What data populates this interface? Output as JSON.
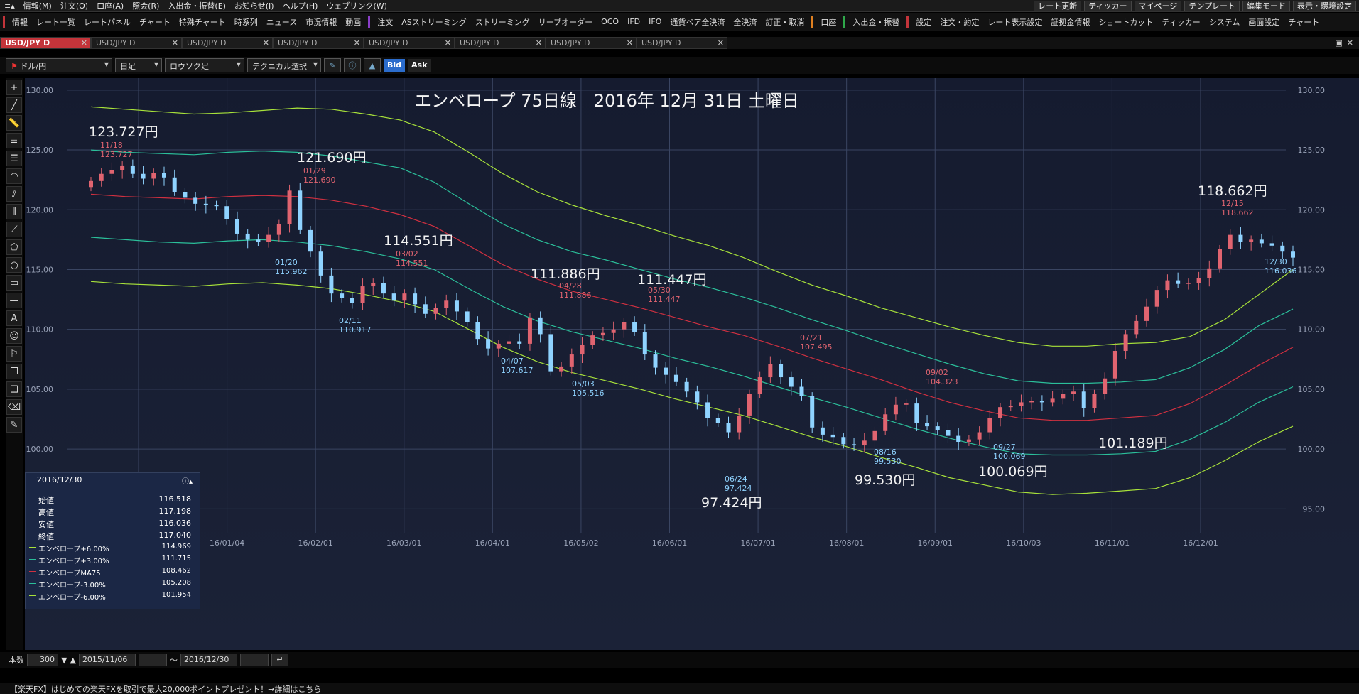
{
  "menu": {
    "left": [
      "情報(M)",
      "注文(O)",
      "口座(A)",
      "照会(R)",
      "入出金・振替(E)",
      "お知らせ(I)",
      "ヘルプ(H)",
      "ウェブリンク(W)"
    ],
    "right": [
      "レート更新",
      "ティッカー",
      "マイページ",
      "テンプレート",
      "編集モード",
      "表示・環境設定"
    ]
  },
  "toolbar": {
    "group1": [
      "情報",
      "レート一覧",
      "レートパネル",
      "チャート",
      "特殊チャート",
      "時系列",
      "ニュース",
      "市況情報",
      "動画"
    ],
    "group2": [
      "注文",
      "ASストリーミング",
      "ストリーミング",
      "リーブオーダー",
      "OCO",
      "IFD",
      "IFO",
      "通貨ペア全決済",
      "全決済",
      "訂正・取消"
    ],
    "group3": [
      "口座"
    ],
    "group4": [
      "入出金・振替"
    ],
    "group5": [
      "設定",
      "注文・約定",
      "レート表示設定",
      "証拠金情報",
      "ショートカット",
      "ティッカー",
      "システム",
      "画面設定",
      "チャート"
    ]
  },
  "tabs": [
    "USD/JPY D",
    "USD/JPY D",
    "USD/JPY D",
    "USD/JPY D",
    "USD/JPY D",
    "USD/JPY D",
    "USD/JPY D",
    "USD/JPY D"
  ],
  "chart_toolbar": {
    "pair": "ドル/円",
    "period": "日足",
    "chart_type": "ロウソク足",
    "technical": "テクニカル選択",
    "bid": "Bid",
    "ask": "Ask"
  },
  "chart_title": "エンベロープ 75日線　2016年 12月 31日 土曜日",
  "colors": {
    "up": "#e06470",
    "down": "#8fd3ff",
    "ma": "#d03040",
    "env3": "#2bbf9a",
    "env6": "#a8e23a",
    "grid": "#3a4562",
    "axis_text": "#9aa3b8"
  },
  "chart_data": {
    "type": "candlestick",
    "ylim": [
      93.0,
      131.0
    ],
    "y_ticks": [
      "130.00",
      "125.00",
      "120.00",
      "115.00",
      "110.00",
      "105.00",
      "100.00",
      "95.00"
    ],
    "x_ticks": [
      "15/12/01",
      "16/01/04",
      "16/02/01",
      "16/03/01",
      "16/04/01",
      "16/05/02",
      "16/06/01",
      "16/07/01",
      "16/08/01",
      "16/09/01",
      "16/10/03",
      "16/11/01",
      "16/12/01"
    ],
    "series": [
      {
        "name": "エンベロープ+6.00%",
        "values": [
          128.6,
          128.4,
          128.2,
          128.0,
          128.1,
          128.3,
          128.5,
          128.4,
          128.0,
          127.5,
          126.5,
          124.8,
          123.0,
          121.5,
          120.4,
          119.5,
          118.7,
          117.8,
          117.0,
          116.0,
          114.8,
          113.7,
          112.8,
          111.8,
          111.0,
          110.2,
          109.5,
          108.9,
          108.6,
          108.6,
          108.8,
          108.9,
          109.4,
          110.8,
          112.9,
          115.0
        ]
      },
      {
        "name": "エンベロープ+3.00%",
        "values": [
          125.0,
          124.8,
          124.7,
          124.6,
          124.8,
          124.9,
          124.8,
          124.5,
          124.0,
          123.5,
          122.3,
          120.5,
          118.8,
          117.5,
          116.5,
          115.8,
          115.0,
          114.2,
          113.5,
          112.7,
          111.8,
          110.8,
          109.9,
          108.9,
          108.0,
          107.1,
          106.3,
          105.7,
          105.5,
          105.5,
          105.6,
          105.8,
          106.8,
          108.3,
          110.3,
          111.7
        ]
      },
      {
        "name": "エンベロープ MA75",
        "values": [
          121.3,
          121.1,
          121.0,
          120.9,
          121.1,
          121.2,
          121.1,
          120.8,
          120.3,
          119.6,
          118.6,
          117.0,
          115.4,
          114.2,
          113.2,
          112.5,
          111.8,
          111.0,
          110.2,
          109.5,
          108.6,
          107.6,
          106.7,
          105.8,
          104.8,
          103.9,
          103.2,
          102.6,
          102.4,
          102.4,
          102.6,
          102.8,
          103.8,
          105.3,
          107.0,
          108.5
        ]
      },
      {
        "name": "エンベロープ-3.00%",
        "values": [
          117.7,
          117.5,
          117.3,
          117.2,
          117.4,
          117.5,
          117.3,
          117.0,
          116.5,
          115.9,
          115.0,
          113.4,
          111.9,
          110.7,
          109.8,
          109.1,
          108.4,
          107.6,
          106.9,
          106.1,
          105.2,
          104.3,
          103.5,
          102.6,
          101.7,
          100.9,
          100.2,
          99.6,
          99.5,
          99.5,
          99.6,
          99.8,
          100.8,
          102.2,
          103.9,
          105.2
        ]
      },
      {
        "name": "エンベロープ-6.00%",
        "values": [
          114.0,
          113.8,
          113.7,
          113.6,
          113.8,
          113.9,
          113.7,
          113.4,
          112.9,
          112.3,
          111.5,
          110.0,
          108.5,
          107.3,
          106.4,
          105.7,
          105.0,
          104.2,
          103.5,
          102.8,
          101.9,
          101.0,
          100.2,
          99.3,
          98.5,
          97.6,
          97.0,
          96.4,
          96.2,
          96.3,
          96.5,
          96.7,
          97.6,
          99.0,
          100.6,
          101.9
        ]
      }
    ],
    "candles_close": [
      122.4,
      123.0,
      123.3,
      123.7,
      123.0,
      122.6,
      123.1,
      122.7,
      121.5,
      121.0,
      120.5,
      120.4,
      120.3,
      119.2,
      118.0,
      117.5,
      117.3,
      117.9,
      118.8,
      121.6,
      118.3,
      116.5,
      114.5,
      113.0,
      112.6,
      112.2,
      113.6,
      113.9,
      113.0,
      112.4,
      113.0,
      112.1,
      111.3,
      111.8,
      112.4,
      111.5,
      110.6,
      109.2,
      108.4,
      108.8,
      109.0,
      108.8,
      111.0,
      109.6,
      106.5,
      106.9,
      107.9,
      108.7,
      109.5,
      109.7,
      110.0,
      110.6,
      109.8,
      107.9,
      106.8,
      106.2,
      105.6,
      104.8,
      103.9,
      102.6,
      102.2,
      101.4,
      102.8,
      104.6,
      106.0,
      107.1,
      106.0,
      105.2,
      104.4,
      101.8,
      101.2,
      101.0,
      100.4,
      100.3,
      100.7,
      101.5,
      102.9,
      103.7,
      103.8,
      102.2,
      101.9,
      101.6,
      101.1,
      100.6,
      100.8,
      101.4,
      102.6,
      103.5,
      103.6,
      103.9,
      104.0,
      103.9,
      104.2,
      104.6,
      104.8,
      103.4,
      104.6,
      105.9,
      108.2,
      109.6,
      110.7,
      111.9,
      113.3,
      114.1,
      113.8,
      113.9,
      114.3,
      115.1,
      116.7,
      117.9,
      117.3,
      117.5,
      117.2,
      117.0,
      116.5,
      116.0
    ]
  },
  "annotations": {
    "big": [
      "123.727円",
      "121.690円",
      "114.551円",
      "111.886円",
      "111.447円",
      "118.662円",
      "97.424円",
      "99.530円",
      "100.069円",
      "101.189円"
    ],
    "small_hi": [
      [
        "11/18",
        "123.727"
      ],
      [
        "01/29",
        "121.690"
      ],
      [
        "03/02",
        "114.551"
      ],
      [
        "04/28",
        "111.886"
      ],
      [
        "05/30",
        "111.447"
      ],
      [
        "07/21",
        "107.495"
      ],
      [
        "09/02",
        "104.323"
      ],
      [
        "12/15",
        "118.662"
      ]
    ],
    "small_lo": [
      [
        "01/20",
        "115.962"
      ],
      [
        "02/11",
        "110.917"
      ],
      [
        "04/07",
        "107.617"
      ],
      [
        "05/03",
        "105.516"
      ],
      [
        "06/24",
        "97.424"
      ],
      [
        "08/16",
        "99.530"
      ],
      [
        "09/27",
        "100.069"
      ],
      [
        "12/30",
        "116.036"
      ]
    ]
  },
  "info_box": {
    "date": "2016/12/30",
    "rows": [
      {
        "label": "始値",
        "value": "116.518"
      },
      {
        "label": "高値",
        "value": "117.198"
      },
      {
        "label": "安値",
        "value": "116.036"
      },
      {
        "label": "終値",
        "value": "117.040"
      }
    ],
    "indicators": [
      {
        "label": "エンベロープ+6.00%",
        "value": "114.969",
        "color": "#a8e23a"
      },
      {
        "label": "エンベロープ+3.00%",
        "value": "111.715",
        "color": "#2bbf9a"
      },
      {
        "label": "エンベロープMA75",
        "value": "108.462",
        "color": "#d03040"
      },
      {
        "label": "エンベロープ-3.00%",
        "value": "105.208",
        "color": "#2bbf9a"
      },
      {
        "label": "エンベロープ-6.00%",
        "value": "101.954",
        "color": "#a8e23a"
      }
    ]
  },
  "bottom": {
    "count_label": "本数",
    "count_value": "300",
    "from": "2015/11/06",
    "tilde": "～",
    "to": "2016/12/30"
  },
  "status_text": "【楽天FX】はじめての楽天FXを取引で最大20,000ポイントプレゼント！→詳細はこちら"
}
